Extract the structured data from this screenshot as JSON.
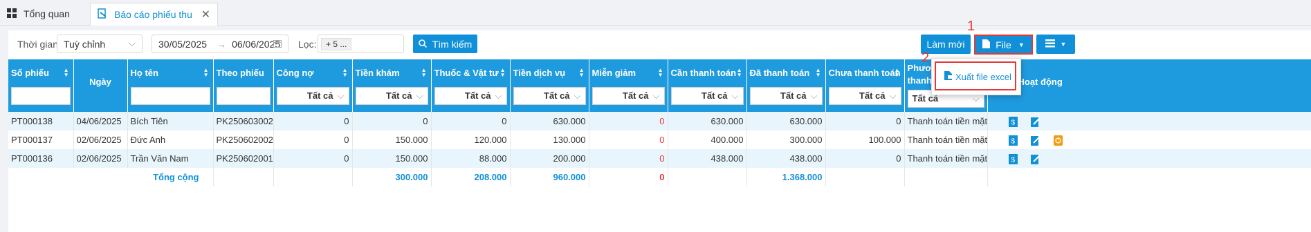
{
  "tabs": [
    {
      "label": "Tổng quan",
      "icon": "dashboard-icon"
    },
    {
      "label": "Báo cáo phiếu thu",
      "icon": "report-icon"
    }
  ],
  "filters": {
    "time_label": "Thời gian:",
    "time_value": "Tuỳ chỉnh",
    "date_from": "30/05/2025",
    "date_to": "06/06/2025",
    "filter_label": "Lọc:",
    "filter_value": "+ 5 ...",
    "search_label": "Tìm kiếm"
  },
  "toolbar": {
    "refresh_label": "Làm mới",
    "file_label": "File",
    "export_excel_label": "Xuất file excel"
  },
  "annotations": {
    "n1": "1",
    "n2": "2"
  },
  "table": {
    "headers": [
      "Số phiếu",
      "Ngày",
      "Họ tên",
      "Theo phiếu",
      "Công nợ",
      "Tiền khám",
      "Thuốc & Vật tư",
      "Tiền dịch vụ",
      "Miễn giảm",
      "Cần thanh toán",
      "Đã thanh toán",
      "Chưa thanh toán",
      "Phương thức thanh toán",
      "Hoạt động"
    ],
    "filter_all": "Tất cả",
    "rows": [
      {
        "so_phieu": "PT000138",
        "ngay": "04/06/2025",
        "ho_ten": "Bích Tiên",
        "theo_phieu": "PK250603002",
        "cong_no": "0",
        "tien_kham": "0",
        "thuoc": "0",
        "dich_vu": "630.000",
        "mien_giam": "0",
        "can_tt": "630.000",
        "da_tt": "630.000",
        "chua_tt": "0",
        "pttt": "Thanh toán tiền mặt"
      },
      {
        "so_phieu": "PT000137",
        "ngay": "02/06/2025",
        "ho_ten": "Đức Anh",
        "theo_phieu": "PK250602002",
        "cong_no": "0",
        "tien_kham": "150.000",
        "thuoc": "120.000",
        "dich_vu": "130.000",
        "mien_giam": "0",
        "can_tt": "400.000",
        "da_tt": "300.000",
        "chua_tt": "100.000",
        "pttt": "Thanh toán tiền mặt"
      },
      {
        "so_phieu": "PT000136",
        "ngay": "02/06/2025",
        "ho_ten": "Trần Văn Nam",
        "theo_phieu": "PK250602001",
        "cong_no": "0",
        "tien_kham": "150.000",
        "thuoc": "88.000",
        "dich_vu": "200.000",
        "mien_giam": "0",
        "can_tt": "438.000",
        "da_tt": "438.000",
        "chua_tt": "0",
        "pttt": "Thanh toán tiền mặt"
      }
    ],
    "total": {
      "label": "Tổng cộng",
      "tien_kham": "300.000",
      "thuoc": "208.000",
      "dich_vu": "960.000",
      "mien_giam": "0",
      "da_tt": "1.368.000"
    }
  },
  "colors": {
    "primary": "#1090d8",
    "header_bg": "#1e9bdf",
    "highlight": "#e53935",
    "row_alt": "#e8f5fc"
  }
}
